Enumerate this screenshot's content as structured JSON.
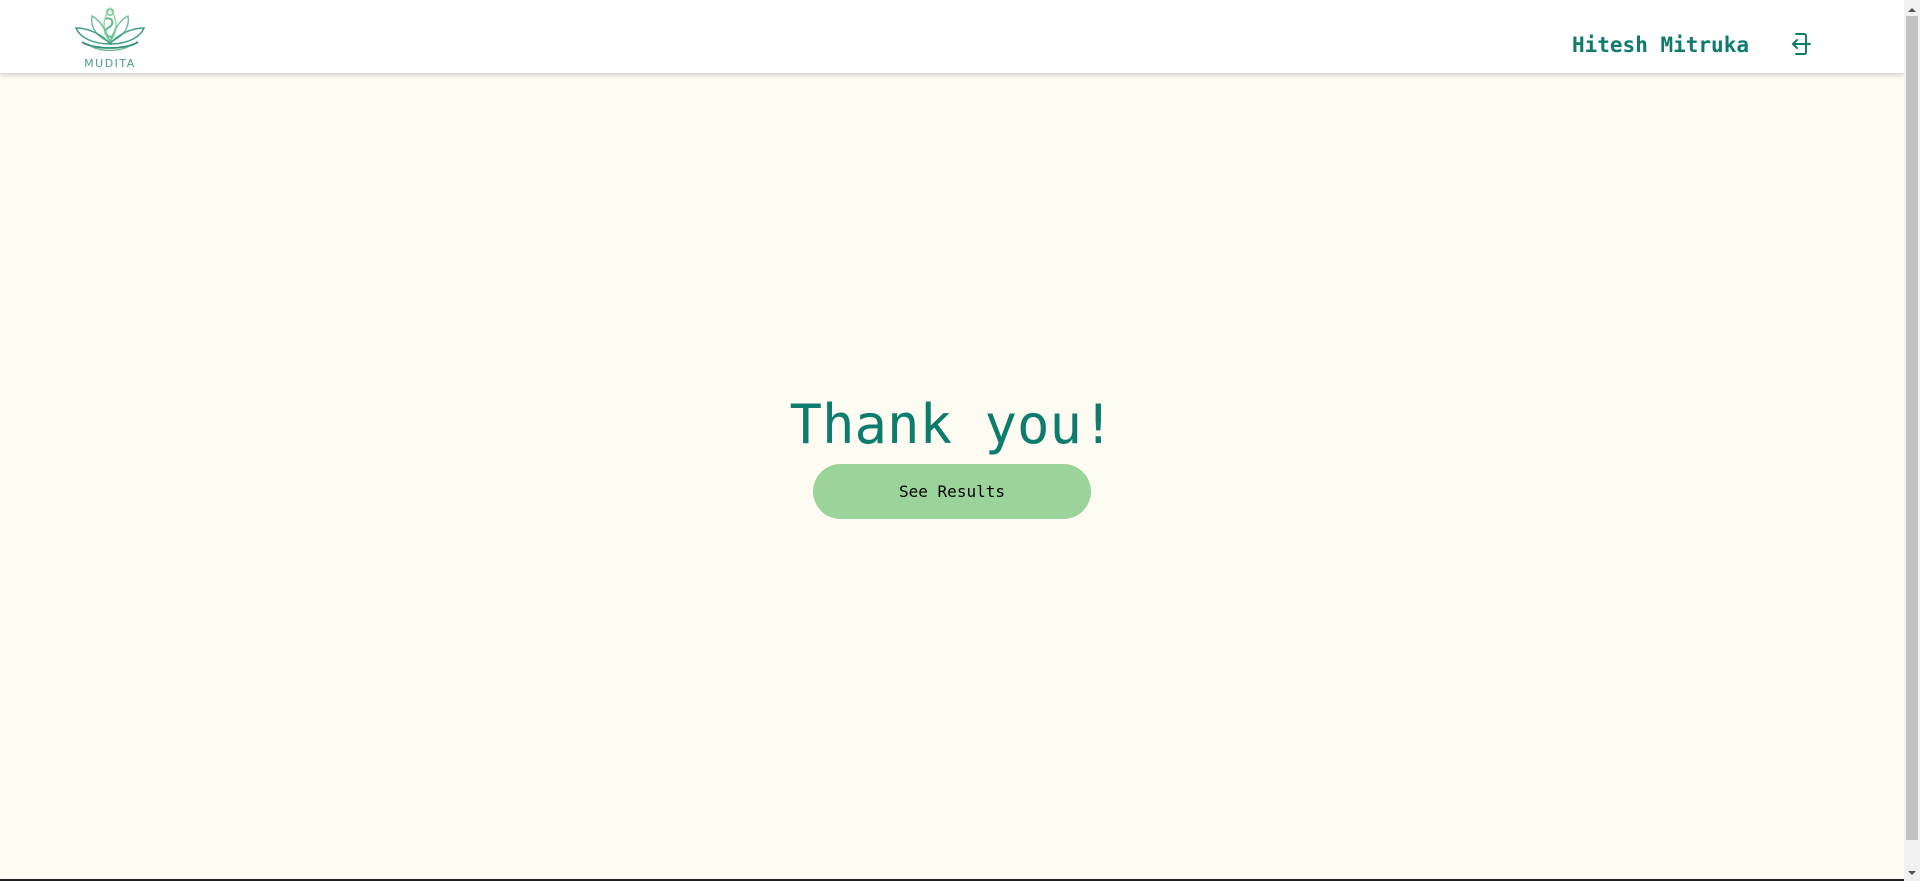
{
  "header": {
    "logo_text": "MUDITA",
    "user_name": "Hitesh Mitruka",
    "logout_icon": "logout-icon"
  },
  "main": {
    "heading": "Thank you!",
    "button_label": "See Results"
  },
  "colors": {
    "brand_teal": "#0e7c6b",
    "button_green": "#9bd49a",
    "page_background": "#fefbf3",
    "logo_green": "#4a9d8a"
  }
}
